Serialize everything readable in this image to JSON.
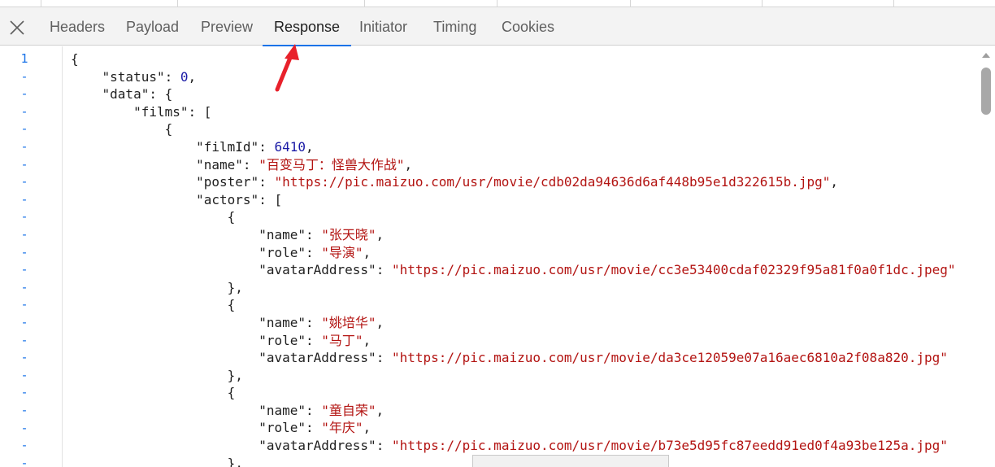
{
  "tabs": [
    {
      "label": "Headers",
      "active": false
    },
    {
      "label": "Payload",
      "active": false
    },
    {
      "label": "Preview",
      "active": false
    },
    {
      "label": "Response",
      "active": true
    },
    {
      "label": "Initiator",
      "active": false
    },
    {
      "label": "Timing",
      "active": false
    },
    {
      "label": "Cookies",
      "active": false
    }
  ],
  "gutter": [
    "1",
    "-",
    "-",
    "-",
    "-",
    "-",
    "-",
    "-",
    "-",
    "-",
    "-",
    "-",
    "-",
    "-",
    "-",
    "-",
    "-",
    "-",
    "-",
    "-",
    "-",
    "-",
    "-",
    "-"
  ],
  "code_lines": [
    "{",
    "    \"status\": 0,",
    "    \"data\": {",
    "        \"films\": [",
    "            {",
    "                \"filmId\": 6410,",
    "                \"name\": \"百变马丁：怪兽大作战\",",
    "                \"poster\": \"https://pic.maizuo.com/usr/movie/cdb02da94636d6af448b95e1d322615b.jpg\",",
    "                \"actors\": [",
    "                    {",
    "                        \"name\": \"张天晓\",",
    "                        \"role\": \"导演\",",
    "                        \"avatarAddress\": \"https://pic.maizuo.com/usr/movie/cc3e53400cdaf02329f95a81f0a0f1dc.jpeg\"",
    "                    },",
    "                    {",
    "                        \"name\": \"姚培华\",",
    "                        \"role\": \"马丁\",",
    "                        \"avatarAddress\": \"https://pic.maizuo.com/usr/movie/da3ce12059e07a16aec6810a2f08a820.jpg\"",
    "                    },",
    "                    {",
    "                        \"name\": \"童自荣\",",
    "                        \"role\": \"年庆\",",
    "                        \"avatarAddress\": \"https://pic.maizuo.com/usr/movie/b73e5d95fc87eedd91ed0f4a93be125a.jpg\"",
    "                    },"
  ],
  "colors": {
    "accent": "#1a73e8",
    "string": "#b31412",
    "number": "#1a1aa6",
    "annotation_arrow": "#e8212b"
  },
  "icons": {
    "close": "close-icon",
    "annotation": "red-arrow-annotation"
  }
}
